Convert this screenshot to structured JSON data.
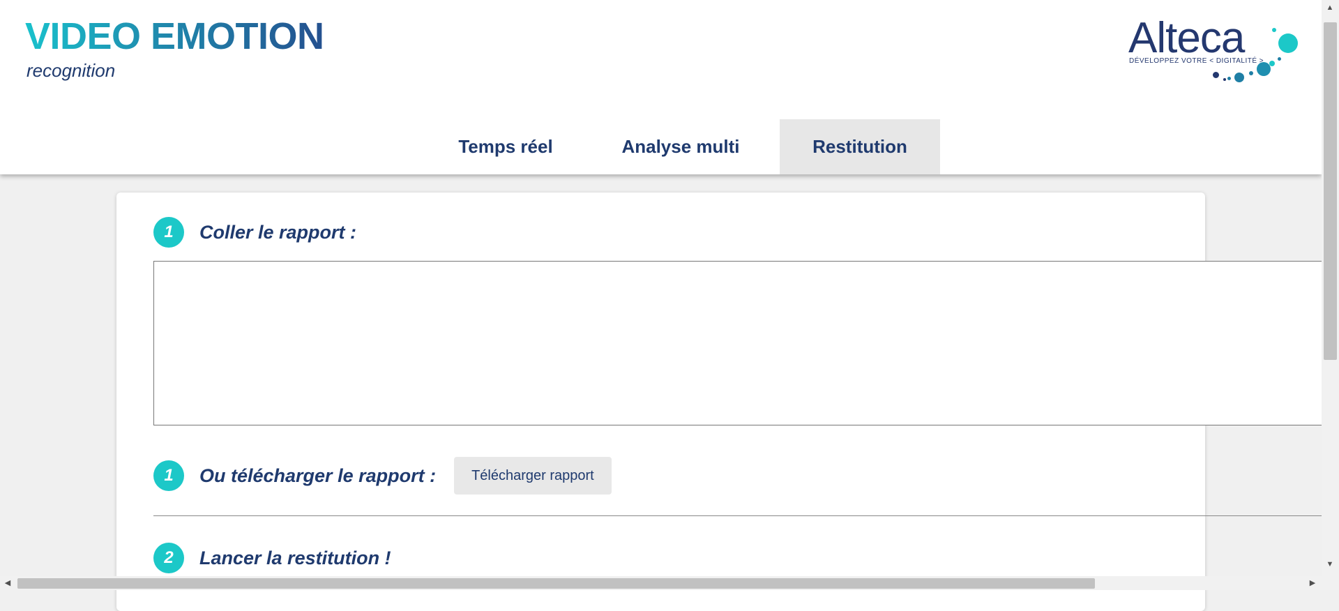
{
  "header": {
    "title": "VIDEO EMOTION",
    "subtitle": "recognition",
    "logo": {
      "name": "Alteca",
      "tagline": "DÉVELOPPEZ VOTRE < DIGITALITÉ >",
      "colors": {
        "text": "#24386f",
        "accent": "#1cc8c8",
        "dots": "#1f7fa5"
      }
    }
  },
  "tabs": [
    {
      "label": "Temps réel",
      "active": false
    },
    {
      "label": "Analyse multi",
      "active": false
    },
    {
      "label": "Restitution",
      "active": true
    }
  ],
  "form": {
    "step_paste": {
      "number": "1",
      "label": "Coller le rapport :"
    },
    "report_text": {
      "value": "",
      "placeholder": ""
    },
    "step_upload": {
      "number": "1",
      "label": "Ou télécharger le rapport :",
      "button_label": "Télécharger rapport"
    },
    "step_launch": {
      "number": "2",
      "label": "Lancer la restitution !"
    }
  },
  "colors": {
    "brand_navy": "#1f3a6e",
    "brand_teal": "#1cc8c8",
    "tab_active_bg": "#e7e7e7"
  },
  "icons": {
    "scroll_up": "▲",
    "scroll_down": "▼",
    "scroll_left": "◀",
    "scroll_right": "▶"
  }
}
